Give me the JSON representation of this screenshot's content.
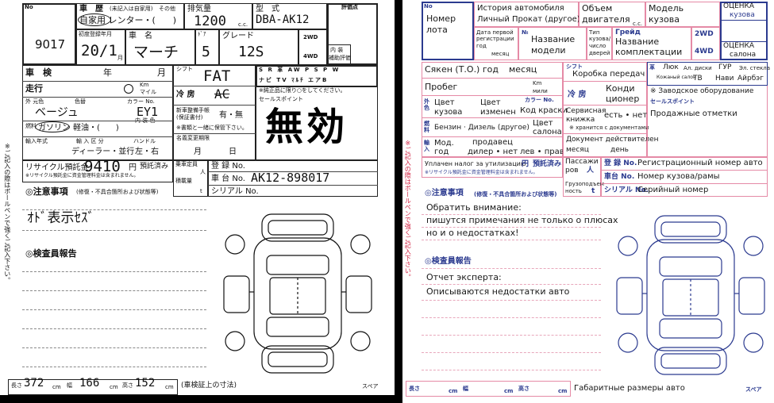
{
  "left": {
    "corner_no": "No",
    "lot_number": "9017",
    "history_label": "車　歴",
    "history_note": "(未記入は自家用)",
    "history_other": "その他",
    "history_options": "自家用 レンター・(　　)",
    "displacement_label": "排気量",
    "displacement_value": "1200",
    "displacement_unit": "c.c.",
    "model_label": "型　式",
    "model_value": "DBA-AK12",
    "score_label": "評価点",
    "first_reg_label": "初度登録年月",
    "first_reg_value": "20/1",
    "first_reg_month": "月",
    "car_name_label": "車　名",
    "car_name_value": "マーチ",
    "doors_label": "ﾄﾞｱ",
    "doors_value": "5",
    "grade_label": "グレード",
    "grade_value": "12S",
    "drive_2wd": "2WD",
    "drive_4wd": "4WD",
    "interior_label": "内 装",
    "interior_sub": "補助評価",
    "inspection_label": "車　検",
    "inspection_year": "年",
    "inspection_month": "月",
    "mileage_label": "走行",
    "mileage_unit_km": "Km",
    "mileage_unit_mile": "マイル",
    "color_label": "外 元色",
    "color_code_label": "色替",
    "color_label2": "カラー No.",
    "color_value": "ベージュ",
    "color_code": "EY1",
    "interior_color_label": "内 装 色",
    "fuel_label": "燃料",
    "fuel_value": "ガソリン",
    "fuel_light": "軽油・(　　)",
    "import_label": "輸入",
    "import_year": "年式",
    "import_type": "輸 入 区 分",
    "handle_label": "ハンドル",
    "dealer_label": "ディーラー・並行",
    "handle_value": "左・右",
    "shift_label": "シフト",
    "shift_value": "FAT",
    "ac_label": "冷 房",
    "ac_value": "AC",
    "equip_row1": "S R 革 AW P S P W",
    "equip_row2": "ナビ TV ﾏﾙﾁ エアB",
    "equip_note": "※純正品に限り○をしてください。",
    "selling_points_label": "セールスポイント",
    "stamp_text": "無効",
    "new_car_warranty_label": "新車整備手帳",
    "new_car_warranty_sub": "(保証書付)",
    "warranty_value": "有・無",
    "warranty_note": "※書類と一緒に保管下さい。",
    "name_change_label": "名義変更期限",
    "name_change_month": "月",
    "name_change_day": "日",
    "recycle_label": "リサイクル預託金",
    "recycle_value": "9410",
    "recycle_unit": "円",
    "recycle_deposit": "預託済み",
    "recycle_note": "※リサイクル預託金に資金管理料金は含まれません。",
    "capacity_label": "乗車定員",
    "capacity_unit": "人",
    "load_label": "積載量",
    "load_unit": "t",
    "reg_no_label": "登 録 No.",
    "chassis_label": "車 台 No.",
    "chassis_value": "AK12-898017",
    "serial_label": "シリアル No.",
    "notes_label": "◎注意事項",
    "notes_sub": "(修復・不具合箇所および状態等)",
    "notes_handwritten": "ｵﾄﾞ表示ｾｽﾞ",
    "inspector_label": "◎検査員報告",
    "side_note": "※ご記入の際はボールペンで強くご記入下さい。",
    "length_label": "長さ",
    "length_value": "372",
    "width_label": "幅",
    "width_value": "166",
    "height_label": "高さ",
    "height_value": "152",
    "dim_unit": "cm",
    "dims_note": "(車検証上の寸法)",
    "spare_label": "スペア"
  },
  "right": {
    "corner_no": "No",
    "lot_label1": "Номер",
    "lot_label2": "лота",
    "history_label": "История автомобиля",
    "history_options": "Личный  Прокат (другое)",
    "volume_label1": "Объем",
    "volume_label2": "двигателя",
    "volume_unit": "c.c.",
    "model_label1": "Модель",
    "model_label2": "кузова",
    "score_label1": "ОЦЕНКА",
    "score_label2": "кузова",
    "first_reg_small1": "Дата первой",
    "first_reg_small2": "регистрации",
    "first_reg_small3": "год",
    "first_reg_small4": "месяц",
    "car_name_small": "№",
    "model_name1": "Название",
    "model_name2": "модели",
    "body_type1": "Тип",
    "body_type2": "кузова/",
    "body_type3": "число",
    "body_type4": "дверей",
    "grade_label": "Грейд",
    "grade_name1": "Название",
    "grade_name2": "комплектации",
    "drive_2wd": "2WD",
    "drive_4wd": "4WD",
    "interior_score1": "ОЦЕНКА",
    "interior_score2": "салона",
    "inspection_row": "Сякен (Т.О.) год",
    "inspection_month": "месяц",
    "mileage_label": "Пробег",
    "mileage_unit_km": "Km",
    "mileage_unit_mile": "мили",
    "side_outer": "外色",
    "color_body1": "Цвет",
    "color_body2": "кузова",
    "color_changed1": "Цвет",
    "color_changed2": "изменен",
    "color_no_label": "カラー No.",
    "color_code": "Код краски",
    "fuel_types": "Бензин · Дизель (другое)",
    "interior_color1": "Цвет",
    "interior_color2": "салона",
    "side_fuel": "燃料",
    "side_import": "輸入",
    "model_year1": "Мод.",
    "model_year2": "год",
    "seller_label": "продавец",
    "seller_value": "дилер • нет",
    "handle_value": "лев • прав",
    "shift_title": "シフト",
    "shift_label": "Коробка передач",
    "ac_jp": "冷 房",
    "ac_label1": "Конди",
    "ac_label2": "ционер",
    "equip_col1": "Люк",
    "equip_col1_jp": "革",
    "equip_col2_jp": "Ал. диски",
    "equip_col3": "ГУР",
    "equip_col4_jp": "Эл. стекла",
    "equip_skin": "Кожаный салон",
    "equip_tv": "ТВ",
    "equip_navi": "Нави",
    "equip_airbag": "Айрбэг",
    "equip_note": "※ Заводское оборудование",
    "sales_points_jp": "セールスポイント",
    "sales_points": "Продажные отметки",
    "service_book1": "Сервисная",
    "service_book2": "книжка",
    "service_book_value": "есть • нет",
    "service_book_note": "※ хранится с документами",
    "doc_valid1": "Документ действителен",
    "doc_valid2": "месяц",
    "doc_valid3": "день",
    "recycle_label": "Уплачен налог за утилизацию",
    "recycle_unit": "円",
    "recycle_deposit": "預託済み",
    "recycle_note": "※リサイクル預託金に資金管理料金は含まれません。",
    "passengers1": "Пассажи",
    "passengers2": "ров",
    "passengers_unit": "人",
    "load1": "Грузоподъем",
    "load2": "ность",
    "load_unit": "t",
    "reg_no_jp": "登 録 No.",
    "reg_no": "Регистрационный номер авто",
    "chassis_jp": "車台 No.",
    "chassis": "Номер кузова/рамы",
    "serial_jp": "シリアル No.",
    "serial": "Серийный номер",
    "notes_title": "◎注意事項",
    "notes_sub": "(修復・不具合箇所および状態等)",
    "notes_line1": "Обратить внимание:",
    "notes_line2": "пишутся примечания не только о плюсах",
    "notes_line3": "но и о недостатках!",
    "inspector_title": "◎検査員報告",
    "inspector_line1": "Отчет эксперта:",
    "inspector_line2": "Описываются недостатки авто",
    "side_note": "※ご記入の際はボールペンで強くご記入下さい。",
    "length_label": "長さ",
    "width_label": "幅",
    "height_label": "高さ",
    "dim_unit": "cm",
    "dims_note": "Габаритные размеры авто",
    "spare_label": "スペア"
  },
  "colors": {
    "ink": "#111111",
    "blue": "#2b3a8f",
    "pink_border": "#e58aa6",
    "red_side": "#d02040"
  }
}
